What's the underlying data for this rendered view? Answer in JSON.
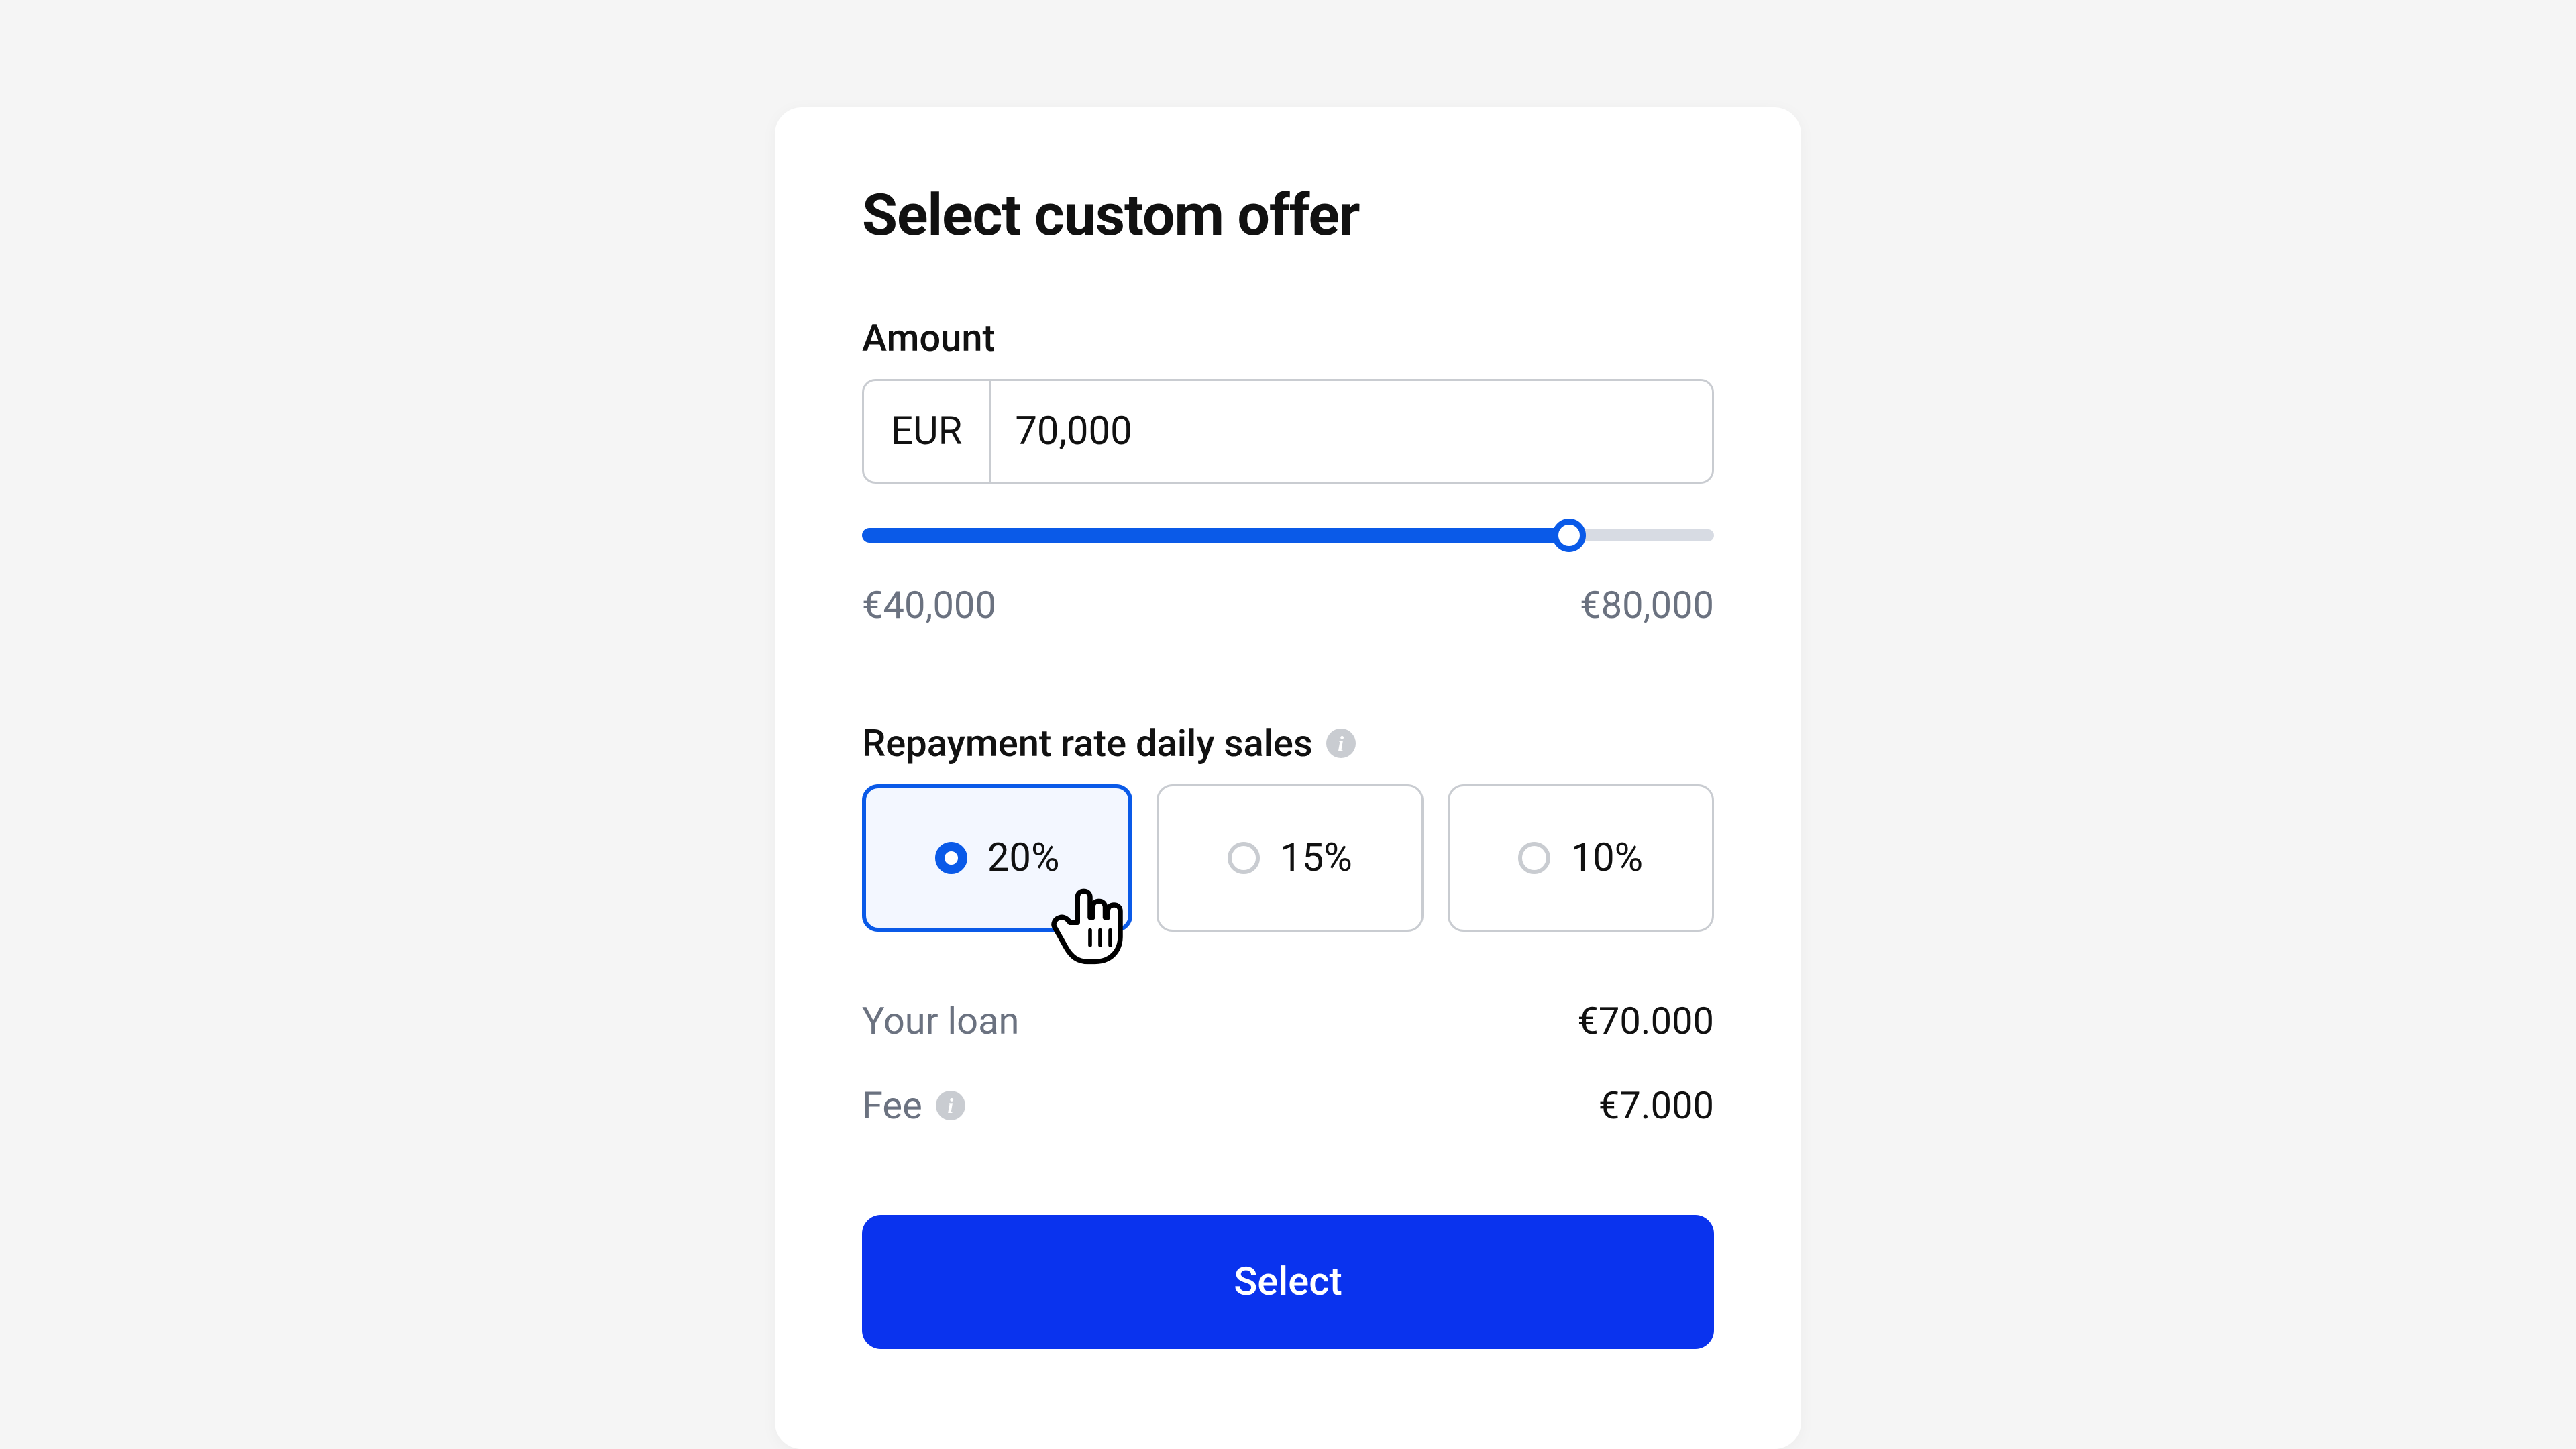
{
  "title": "Select custom offer",
  "amount": {
    "label": "Amount",
    "currency": "EUR",
    "value": "70,000"
  },
  "slider": {
    "min_label": "€40,000",
    "max_label": "€80,000",
    "min": 40000,
    "max": 80000,
    "value": 73000,
    "fill_percent": 84,
    "thumb_percent": 83
  },
  "repayment": {
    "label": "Repayment rate daily sales",
    "options": [
      {
        "label": "20%",
        "selected": true
      },
      {
        "label": "15%",
        "selected": false
      },
      {
        "label": "10%",
        "selected": false
      }
    ]
  },
  "summary": {
    "loan_label": "Your loan",
    "loan_value": "€70.000",
    "fee_label": "Fee",
    "fee_value": "€7.000"
  },
  "button": {
    "label": "Select"
  },
  "colors": {
    "primary": "#0a5ae8",
    "button": "#0a33ee",
    "border": "#c9ccd1",
    "muted": "#6b7280"
  }
}
